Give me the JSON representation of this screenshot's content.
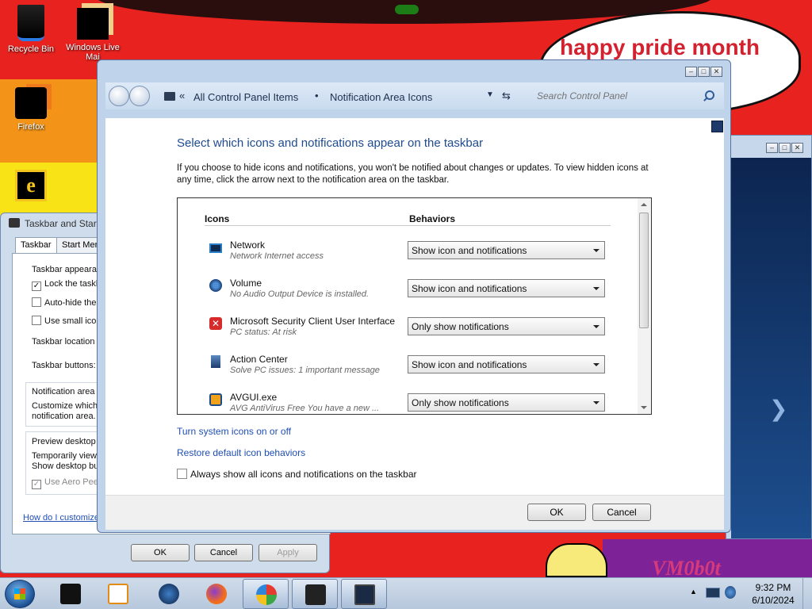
{
  "desktop": {
    "bubble_text": "happy pride month",
    "watermark_text": "VM0b0t",
    "icons": [
      {
        "label": "Recycle Bin"
      },
      {
        "label": "Windows Live Mai"
      },
      {
        "label": "Firefox"
      },
      {
        "label": ""
      }
    ]
  },
  "taskbar_properties": {
    "title": "Taskbar and Start",
    "tabs": [
      "Taskbar",
      "Start Menu"
    ],
    "lines": {
      "appearance": "Taskbar appearan",
      "lock": "Lock the taskb",
      "autohide": "Auto-hide the",
      "small": "Use small icons",
      "location": "Taskbar location o",
      "buttons": "Taskbar buttons:",
      "notif_area": "Notification area",
      "customize1": "Customize which i",
      "customize2": "notification area.",
      "preview": "Preview desktop",
      "temp1": "Temporarily view",
      "temp2": "Show desktop bu",
      "aero": "Use Aero Peek"
    },
    "help_link": "How do I customize",
    "buttons": {
      "ok": "OK",
      "cancel": "Cancel",
      "apply": "Apply"
    }
  },
  "window": {
    "breadcrumb": [
      "All Control Panel Items",
      "Notification Area Icons"
    ],
    "search_placeholder": "Search Control Panel",
    "page_title": "Select which icons and notifications appear on the taskbar",
    "description": "If you choose to hide icons and notifications, you won't be notified about changes or updates. To view hidden icons at any time, click the arrow next to the notification area on the taskbar.",
    "columns": {
      "icons": "Icons",
      "behaviors": "Behaviors"
    },
    "rows": [
      {
        "name": "Network",
        "sub": "Network Internet access",
        "behavior": "Show icon and notifications",
        "icon": "network-icon"
      },
      {
        "name": "Volume",
        "sub": "No Audio Output Device is installed.",
        "behavior": "Show icon and notifications",
        "icon": "volume-icon"
      },
      {
        "name": "Microsoft Security Client User Interface",
        "sub": "PC status: At risk",
        "behavior": "Only show notifications",
        "icon": "security-icon"
      },
      {
        "name": "Action Center",
        "sub": "Solve PC issues: 1 important message",
        "behavior": "Show icon and notifications",
        "icon": "action-center-icon"
      },
      {
        "name": "AVGUI.exe",
        "sub": "AVG AntiVirus Free You have a new ...",
        "behavior": "Only show notifications",
        "icon": "avg-icon"
      }
    ],
    "link_system_icons": "Turn system icons on or off",
    "link_restore": "Restore default icon behaviors",
    "always_show_label": "Always show all icons and notifications on the taskbar",
    "always_show_checked": false,
    "ok": "OK",
    "cancel": "Cancel"
  },
  "taskbar": {
    "time": "9:32 PM",
    "date": "6/10/2024"
  },
  "colors": {
    "accent_title": "#1e4b8f",
    "link": "#1f4fb5",
    "desktop_red": "#e8231f"
  }
}
